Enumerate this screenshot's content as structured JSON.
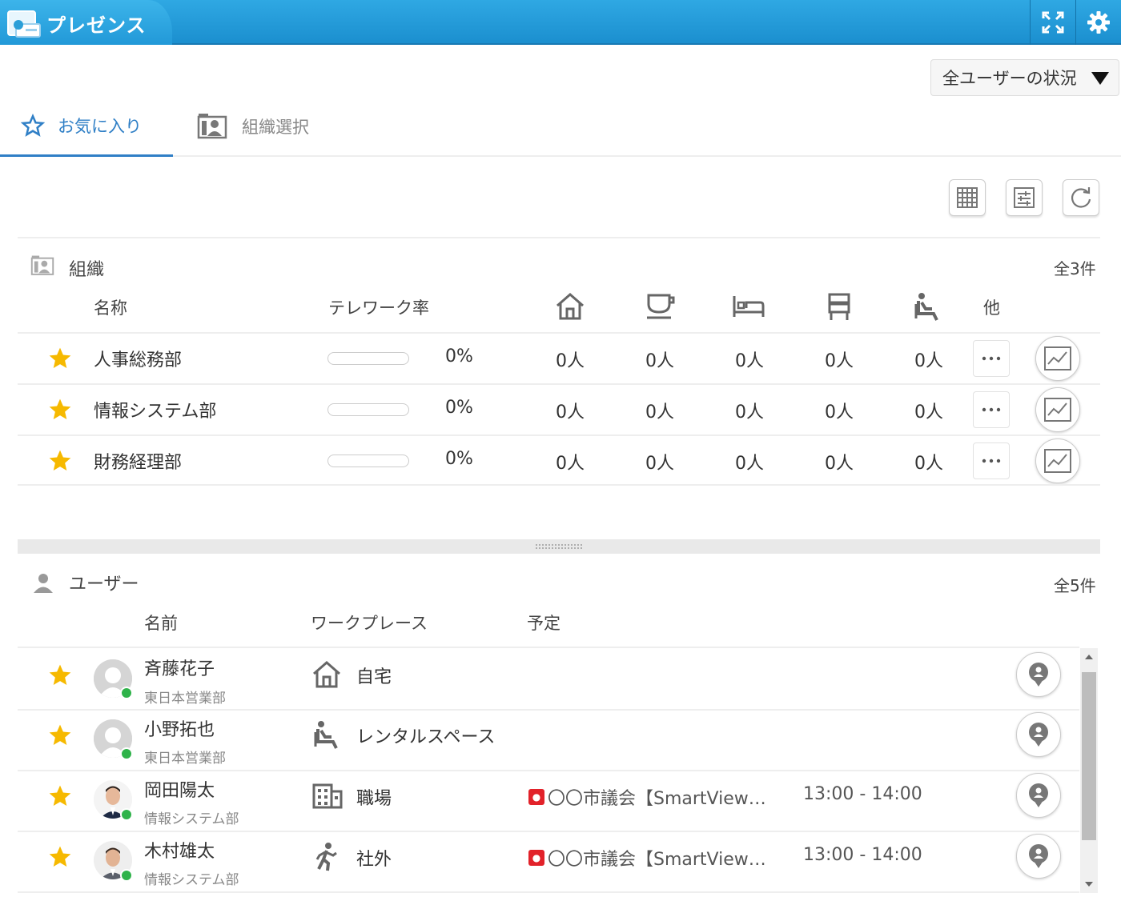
{
  "app": {
    "title": "プレゼンス"
  },
  "status_filter": {
    "selected": "全ユーザーの状況"
  },
  "tabs": [
    {
      "label": "お気に入り",
      "active": true
    },
    {
      "label": "組織選択",
      "active": false
    }
  ],
  "org_section": {
    "title": "組織",
    "count": "全3件",
    "headers": {
      "name": "名称",
      "telework_rate": "テレワーク率",
      "other": "他"
    },
    "workplace_icons": [
      "home-icon",
      "cafe-icon",
      "hotel-icon",
      "satellite-office-icon",
      "rental-space-icon"
    ],
    "rows": [
      {
        "name": "人事総務部",
        "rate": "0%",
        "rate_value": 0,
        "counts": [
          "0人",
          "0人",
          "0人",
          "0人",
          "0人"
        ]
      },
      {
        "name": "情報システム部",
        "rate": "0%",
        "rate_value": 0,
        "counts": [
          "0人",
          "0人",
          "0人",
          "0人",
          "0人"
        ]
      },
      {
        "name": "財務経理部",
        "rate": "0%",
        "rate_value": 0,
        "counts": [
          "0人",
          "0人",
          "0人",
          "0人",
          "0人"
        ]
      }
    ]
  },
  "user_section": {
    "title": "ユーザー",
    "count": "全5件",
    "headers": {
      "name": "名前",
      "workplace": "ワークプレース",
      "schedule": "予定"
    },
    "rows": [
      {
        "name": "斉藤花子",
        "dept": "東日本営業部",
        "workplace": "自宅",
        "workplace_icon": "home-icon",
        "schedule_title": "",
        "schedule_time": "",
        "has_photo": false
      },
      {
        "name": "小野拓也",
        "dept": "東日本営業部",
        "workplace": "レンタルスペース",
        "workplace_icon": "rental-space-icon",
        "schedule_title": "",
        "schedule_time": "",
        "has_photo": false
      },
      {
        "name": "岡田陽太",
        "dept": "情報システム部",
        "workplace": "職場",
        "workplace_icon": "office-building-icon",
        "schedule_title": "〇〇市議会【SmartView…",
        "schedule_time": "13:00 - 14:00",
        "has_photo": true
      },
      {
        "name": "木村雄太",
        "dept": "情報システム部",
        "workplace": "社外",
        "workplace_icon": "walking-icon",
        "schedule_title": "〇〇市議会【SmartView…",
        "schedule_time": "13:00 - 14:00",
        "has_photo": true
      }
    ]
  },
  "colors": {
    "accent": "#2f7fc6",
    "title_bar": "#2299d8",
    "star": "#f6b900",
    "online": "#2fb34a",
    "schedule_badge": "#e2222a"
  }
}
